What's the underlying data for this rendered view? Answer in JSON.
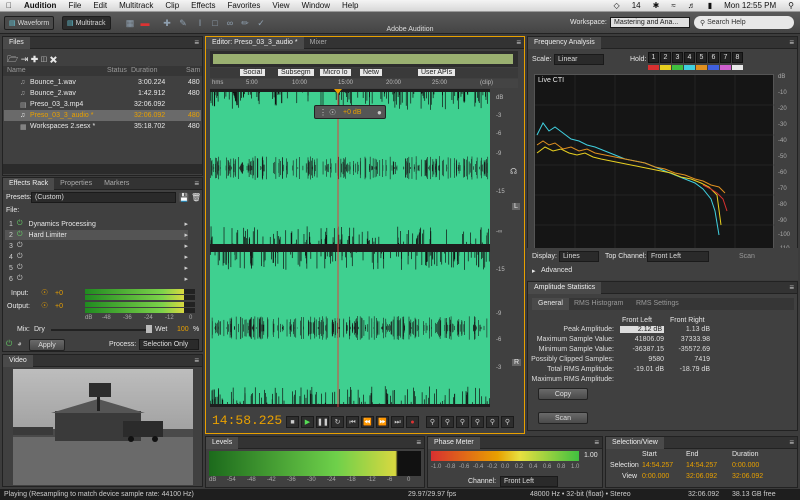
{
  "menubar": {
    "app": "Audition",
    "items": [
      "File",
      "Edit",
      "Multitrack",
      "Clip",
      "Effects",
      "Favorites",
      "View",
      "Window",
      "Help"
    ],
    "battery_label": "14",
    "clock": "Mon 12:55 PM"
  },
  "toolbar": {
    "waveform_label": "Waveform",
    "multitrack_label": "Multitrack",
    "window_title": "Adobe Audition",
    "workspace_label": "Workspace:",
    "workspace_value": "Mastering and Ana...",
    "search_placeholder": "Search Help"
  },
  "files": {
    "tab": "Files",
    "columns": [
      "Name",
      "Status",
      "Duration",
      "Sam"
    ],
    "rows": [
      {
        "name": "Bounce_1.wav",
        "duration": "3:00.224",
        "rate": "480"
      },
      {
        "name": "Bounce_2.wav",
        "duration": "1:42.912",
        "rate": "480"
      },
      {
        "name": "Preso_03_3.mp4",
        "duration": "32:06.092",
        "rate": ""
      },
      {
        "name": "Preso_03_3_audio *",
        "duration": "32:06.092",
        "rate": "480"
      },
      {
        "name": "Workspaces 2.sesx *",
        "duration": "35:18.702",
        "rate": "480"
      }
    ]
  },
  "effects": {
    "tabs": [
      "Effects Rack",
      "Properties",
      "Markers"
    ],
    "presets_label": "Presets:",
    "presets_value": "(Custom)",
    "file_label": "File:",
    "slots": [
      {
        "num": "1",
        "name": "Dynamics Processing"
      },
      {
        "num": "2",
        "name": "Hard Limiter"
      },
      {
        "num": "3",
        "name": ""
      },
      {
        "num": "4",
        "name": ""
      },
      {
        "num": "5",
        "name": ""
      },
      {
        "num": "6",
        "name": ""
      }
    ],
    "input_label": "Input:",
    "input_value": "+0",
    "output_label": "Output:",
    "output_value": "+0",
    "meter_ticks": [
      "dB",
      "-48",
      "-36",
      "-24",
      "-12",
      "0"
    ],
    "mix_label": "Mix:",
    "dry_label": "Dry",
    "wet_label": "Wet",
    "mix_value": "100",
    "mix_unit": "%",
    "apply_label": "Apply",
    "process_label": "Process:",
    "process_value": "Selection Only"
  },
  "video": {
    "tab": "Video"
  },
  "editor": {
    "tabs": [
      "Editor: Preso_03_3_audio *",
      "Mixer"
    ],
    "markers": [
      "Social",
      "Subsegm",
      "Micro lo",
      "Netw",
      "User APIs"
    ],
    "ruler": [
      "hms",
      "5:00",
      "10:00",
      "15:00",
      "20:00",
      "25:00",
      "(clip)"
    ],
    "hud_gain": "+0 dB",
    "db_scale": [
      "dB",
      "-3",
      "-6",
      "-9",
      "-15",
      "-∞",
      "-15",
      "-9",
      "-6",
      "-3"
    ],
    "channel_top": "L",
    "channel_bottom": "R",
    "time": "14:58.225"
  },
  "freq": {
    "tab": "Frequency Analysis",
    "scale_label": "Scale:",
    "scale_value": "Linear",
    "hold_label": "Hold:",
    "hold_buttons": [
      "1",
      "2",
      "3",
      "4",
      "5",
      "6",
      "7",
      "8"
    ],
    "hold_colors": [
      "#d83030",
      "#e8d020",
      "#40c040",
      "#40d0e0",
      "#e09020",
      "#4060e0",
      "#d060d0",
      "#e8e8e8"
    ],
    "graph_label": "Live CTI",
    "y_axis": [
      "dB",
      "-10",
      "-20",
      "-30",
      "-40",
      "-50",
      "-60",
      "-70",
      "-80",
      "-90",
      "-100",
      "-110"
    ],
    "x_axis": [
      "Hz",
      "2k",
      "4k",
      "6k",
      "8k",
      "10k",
      "12k",
      "14k",
      "16k",
      "18k",
      "20k",
      "22k"
    ],
    "display_label": "Display:",
    "display_value": "Lines",
    "top_channel_label": "Top Channel:",
    "top_channel_value": "Front Left",
    "scan_label": "Scan",
    "advanced_label": "Advanced"
  },
  "stats": {
    "tab": "Amplitude Statistics",
    "subtabs": [
      "General",
      "RMS Histogram",
      "RMS Settings"
    ],
    "col_left": "Front Left",
    "col_right": "Front Right",
    "rows": [
      {
        "label": "Peak Amplitude:",
        "left": "2.12 dB",
        "right": "1.13 dB"
      },
      {
        "label": "Maximum Sample Value:",
        "left": "41806.09",
        "right": "37333.98"
      },
      {
        "label": "Minimum Sample Value:",
        "left": "-36387.15",
        "right": "-35572.69"
      },
      {
        "label": "Possibly Clipped Samples:",
        "left": "9580",
        "right": "7419"
      },
      {
        "label": "Total RMS Amplitude:",
        "left": "-19.01 dB",
        "right": "-18.79 dB"
      },
      {
        "label": "Maximum RMS Amplitude:",
        "left": "",
        "right": ""
      }
    ],
    "copy_label": "Copy",
    "scan_label": "Scan"
  },
  "levels": {
    "tab": "Levels",
    "ticks": [
      "dB",
      "-54",
      "-48",
      "-42",
      "-36",
      "-30",
      "-24",
      "-18",
      "-12",
      "-6",
      "0"
    ]
  },
  "phase": {
    "tab": "Phase Meter",
    "ticks": [
      "-1.0",
      "-0.8",
      "-0.6",
      "-0.4",
      "-0.2",
      "0.0",
      "0.2",
      "0.4",
      "0.6",
      "0.8",
      "1.0"
    ],
    "value": "1.00",
    "channel_label": "Channel:",
    "channel_value": "Front Left"
  },
  "selview": {
    "tab": "Selection/View",
    "cols": [
      "Start",
      "End",
      "Duration"
    ],
    "selection_label": "Selection",
    "selection": [
      "14:54.257",
      "14:54.257",
      "0:00.000"
    ],
    "view_label": "View",
    "view": [
      "0:00.000",
      "32:06.092",
      "32:06.092"
    ]
  },
  "status": {
    "left": "Playing (Resampling to match device sample rate: 44100 Hz)",
    "fps": "29.97/29.97 fps",
    "format": "48000 Hz • 32-bit (float) • Stereo",
    "duration": "32:06.092",
    "free": "38.13 GB free"
  }
}
